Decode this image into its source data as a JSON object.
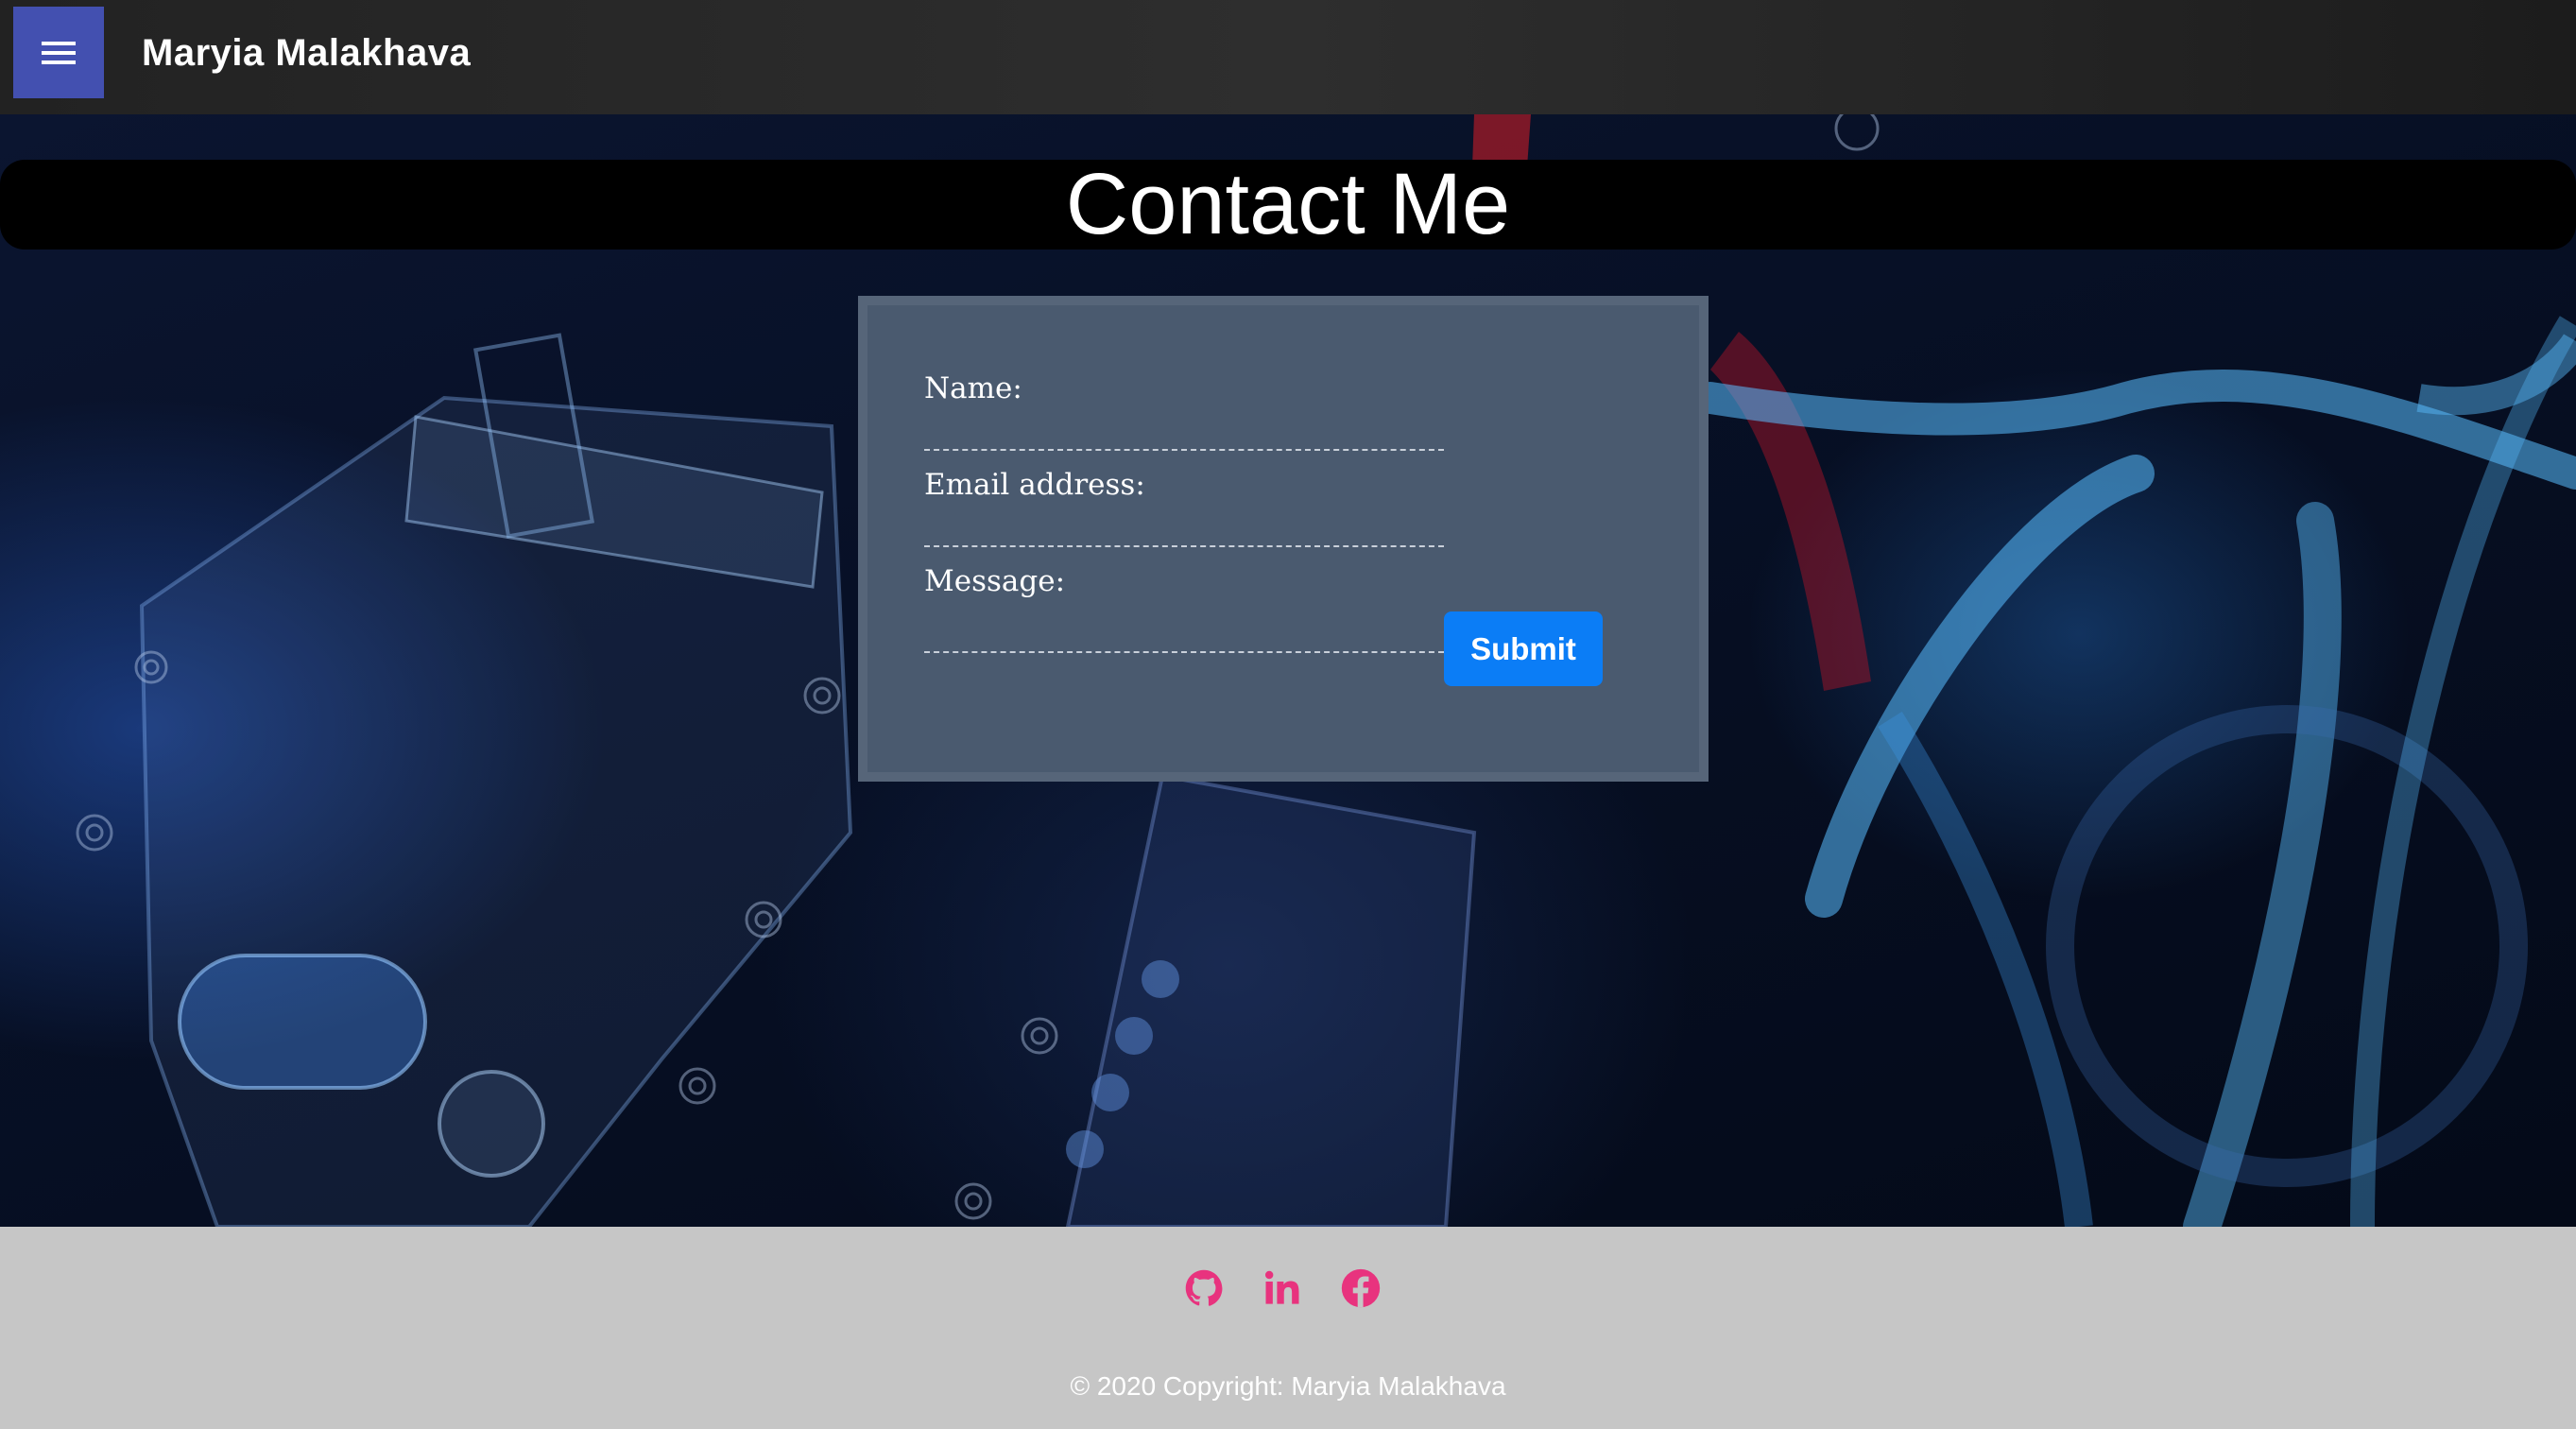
{
  "navbar": {
    "menu_icon": "hamburger-icon",
    "brand": "Maryia Malakhava"
  },
  "page": {
    "title": "Contact Me"
  },
  "form": {
    "name_label": "Name:",
    "name_value": "",
    "email_label": "Email address:",
    "email_value": "",
    "message_label": "Message:",
    "message_value": "",
    "submit_label": "Submit"
  },
  "footer": {
    "social": [
      {
        "icon": "github-icon"
      },
      {
        "icon": "linkedin-icon"
      },
      {
        "icon": "facebook-icon"
      }
    ],
    "copyright": "© 2020 Copyright: Maryia Malakhava"
  },
  "colors": {
    "navbar_bg": "#262626",
    "menu_button": "#4350b0",
    "card_bg": "#4a5a6f",
    "submit_button": "#0b7df6",
    "social_icon": "#e8337e",
    "footer_bg": "#c6c6c6"
  }
}
